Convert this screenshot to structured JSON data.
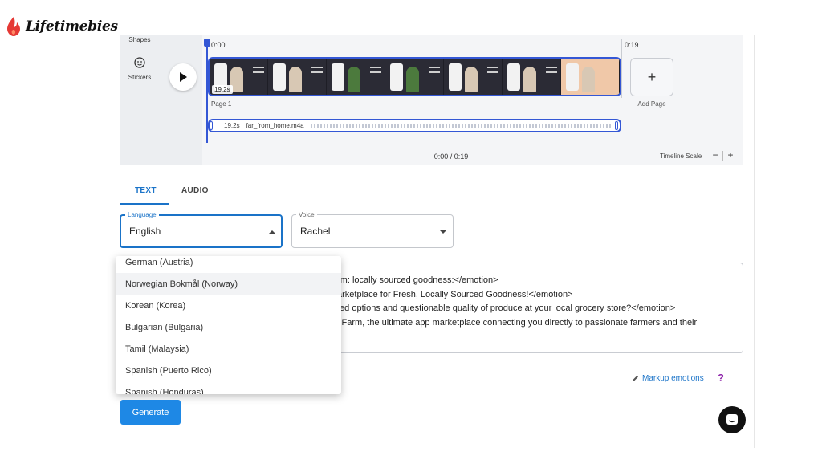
{
  "brand": {
    "logo_text": "Lifetimebies",
    "accent": "#e53935"
  },
  "sidebar": {
    "shapes_label": "Shapes",
    "stickers_label": "Stickers"
  },
  "timeline": {
    "start_time": "0:00",
    "end_time": "0:19",
    "video_duration": "19.2s",
    "page_label": "Page 1",
    "add_page_label": "Add Page",
    "audio_duration": "19.2s",
    "audio_file": "far_from_home.m4a",
    "time_readout": "0:00 / 0:19",
    "scale_label": "Timeline Scale",
    "scale_minus": "−",
    "scale_plus": "+",
    "add_symbol": "+",
    "accent": "#3457d5"
  },
  "tabs": [
    {
      "label": "TEXT",
      "active": true
    },
    {
      "label": "AUDIO",
      "active": false
    }
  ],
  "language": {
    "legend": "Language",
    "value": "English"
  },
  "voice": {
    "legend": "Voice",
    "value": "Rachel"
  },
  "language_menu": {
    "items": [
      "German (Austria)",
      "Norwegian Bokmål (Norway)",
      "Korean (Korea)",
      "Bulgarian (Bulgaria)",
      "Tamil (Malaysia)",
      "Spanish (Puerto Rico)",
      "Spanish (Honduras)"
    ],
    "highlighted_index": 1
  },
  "script_lines": [
    "rm: locally sourced goodness:</emotion>",
    "arketplace for Fresh, Locally Sourced Goodness!</emotion>",
    "ted options and questionable quality of produce at your local grocery store?</emotion>",
    "l Farm, the ultimate app marketplace connecting you directly to passionate farmers and their"
  ],
  "markup_label": "Markup emotions",
  "help_symbol": "?",
  "generate_label": "Generate"
}
